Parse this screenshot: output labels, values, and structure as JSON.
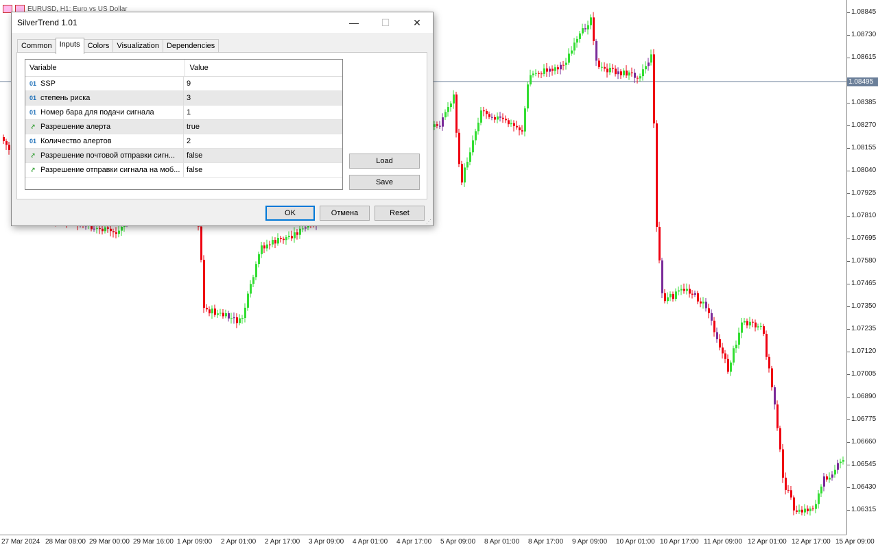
{
  "chart": {
    "header_text": "EURUSD, H1:  Euro vs US Dollar",
    "current_price": "1.08495",
    "price_labels": [
      "1.08845",
      "1.08730",
      "1.08615",
      "1.08385",
      "1.08270",
      "1.08155",
      "1.08040",
      "1.07925",
      "1.07810",
      "1.07695",
      "1.07580",
      "1.07465",
      "1.07350",
      "1.07235",
      "1.07120",
      "1.07005",
      "1.06890",
      "1.06775",
      "1.06660",
      "1.06545",
      "1.06430",
      "1.06315"
    ],
    "time_labels": [
      "27 Mar 2024",
      "28 Mar 08:00",
      "29 Mar 00:00",
      "29 Mar 16:00",
      "1 Apr 09:00",
      "2 Apr 01:00",
      "2 Apr 17:00",
      "3 Apr 09:00",
      "4 Apr 01:00",
      "4 Apr 17:00",
      "5 Apr 09:00",
      "8 Apr 01:00",
      "8 Apr 17:00",
      "9 Apr 09:00",
      "10 Apr 01:00",
      "10 Apr 17:00",
      "11 Apr 09:00",
      "12 Apr 01:00",
      "12 Apr 17:00",
      "15 Apr 09:00"
    ],
    "colors": {
      "bull": "#33dd33",
      "bear": "#ee0011",
      "neutral": "#7a2a99",
      "price_line": "#6b7f99"
    }
  },
  "dialog": {
    "title": "SilverTrend 1.01",
    "tabs": [
      "Common",
      "Inputs",
      "Colors",
      "Visualization",
      "Dependencies"
    ],
    "active_tab": "Inputs",
    "columns": {
      "variable": "Variable",
      "value": "Value"
    },
    "rows": [
      {
        "icon": "01",
        "icon_name": "int-type-icon",
        "name": "SSP",
        "value": "9"
      },
      {
        "icon": "01",
        "icon_name": "int-type-icon",
        "name": "степень риска",
        "value": "3"
      },
      {
        "icon": "01",
        "icon_name": "int-type-icon",
        "name": "Номер бара для подачи сигнала",
        "value": "1"
      },
      {
        "icon": "⤤",
        "icon_name": "bool-type-icon",
        "name": "Разрешение алерта",
        "value": "true"
      },
      {
        "icon": "01",
        "icon_name": "int-type-icon",
        "name": "Количество алертов",
        "value": "2"
      },
      {
        "icon": "⤤",
        "icon_name": "bool-type-icon",
        "name": "Разрешение почтовой отправки сигн...",
        "value": "false"
      },
      {
        "icon": "⤤",
        "icon_name": "bool-type-icon",
        "name": "Разрешение отправки сигнала на моб...",
        "value": "false"
      }
    ],
    "buttons": {
      "load": "Load",
      "save": "Save",
      "ok": "OK",
      "cancel": "Отмена",
      "reset": "Reset"
    }
  }
}
